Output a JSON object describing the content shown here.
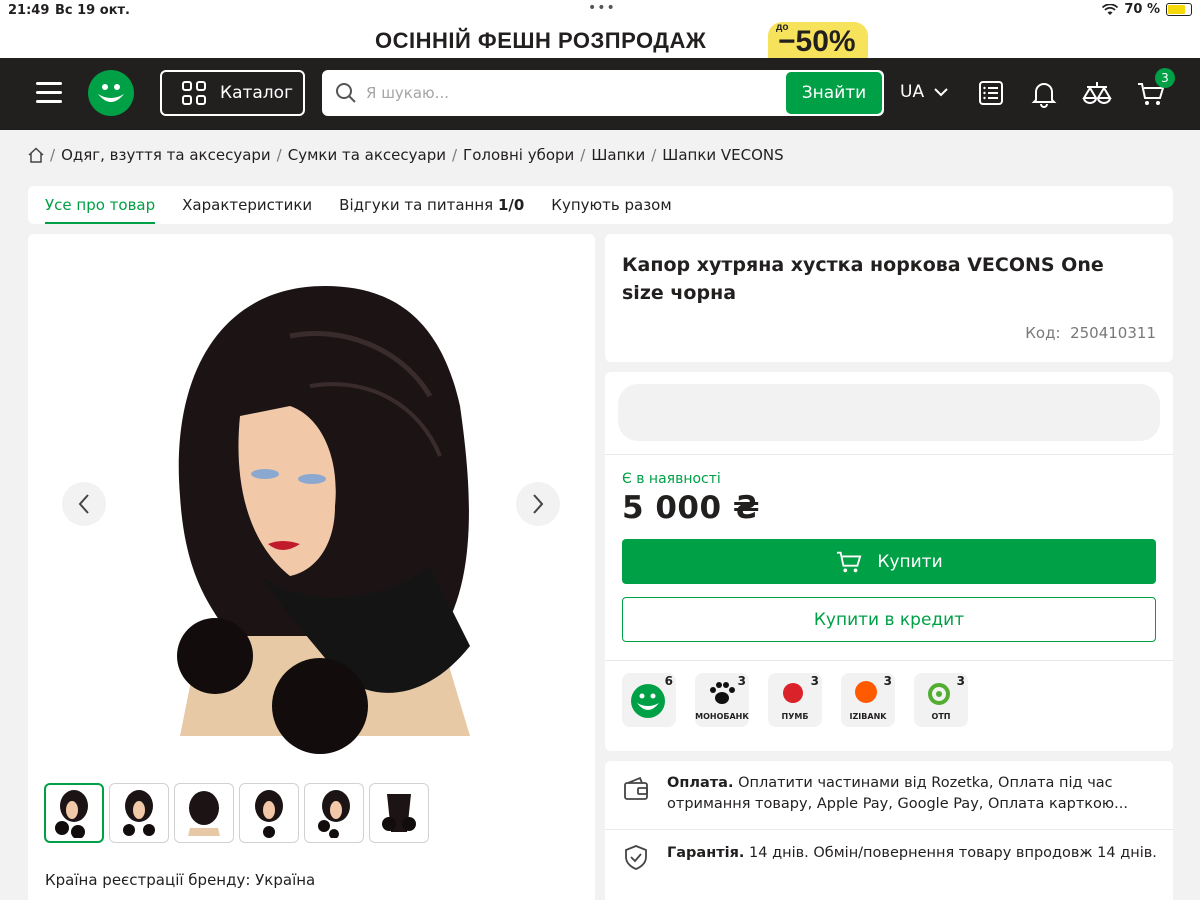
{
  "status": {
    "time": "21:49",
    "date": "Вс 19 окт.",
    "battery": "70 %"
  },
  "promo": {
    "text": "ОСІННІЙ ФЕШН РОЗПРОДАЖ",
    "prefix": "до",
    "discount": "−50%"
  },
  "header": {
    "catalog_label": "Каталог",
    "search_placeholder": "Я шукаю...",
    "search_button": "Знайти",
    "language": "UA",
    "cart_count": "3"
  },
  "breadcrumb": [
    "Одяг, взуття та аксесуари",
    "Сумки та аксесуари",
    "Головні убори",
    "Шапки",
    "Шапки VECONS"
  ],
  "tabs": [
    "Усе про товар",
    "Характеристики",
    "Відгуки та питання",
    "1/0",
    "Купують разом"
  ],
  "product": {
    "title": "Капор хутряна хустка норкова VECONS One size чорна",
    "code_label": "Код:",
    "code": "250410311",
    "availability": "Є в наявності",
    "price": "5 000 ₴",
    "buy_label": "Купити",
    "credit_label": "Купити в кредит",
    "brand_country": "Країна реєстрації бренду: Україна"
  },
  "banks": [
    {
      "name": "rozetka",
      "count": "6",
      "label": ""
    },
    {
      "name": "monobank",
      "count": "3",
      "label": "МОНОБАНК"
    },
    {
      "name": "pumb",
      "count": "3",
      "label": "ПУМБ"
    },
    {
      "name": "izibank",
      "count": "3",
      "label": "IZIBANK"
    },
    {
      "name": "otp",
      "count": "3",
      "label": "ОТП"
    }
  ],
  "info": {
    "payment_title": "Оплата.",
    "payment_text": "Оплатити частинами від Rozetka, Оплата під час отримання товару, Apple Pay, Google Pay, Оплата карткою...",
    "warranty_title": "Гарантія.",
    "warranty_text": "14 днів. Обмін/повернення товару впродовж 14 днів."
  },
  "colors": {
    "brand_green": "#00a046",
    "header_dark": "#221f1f",
    "promo_yellow": "#f7e35b"
  }
}
